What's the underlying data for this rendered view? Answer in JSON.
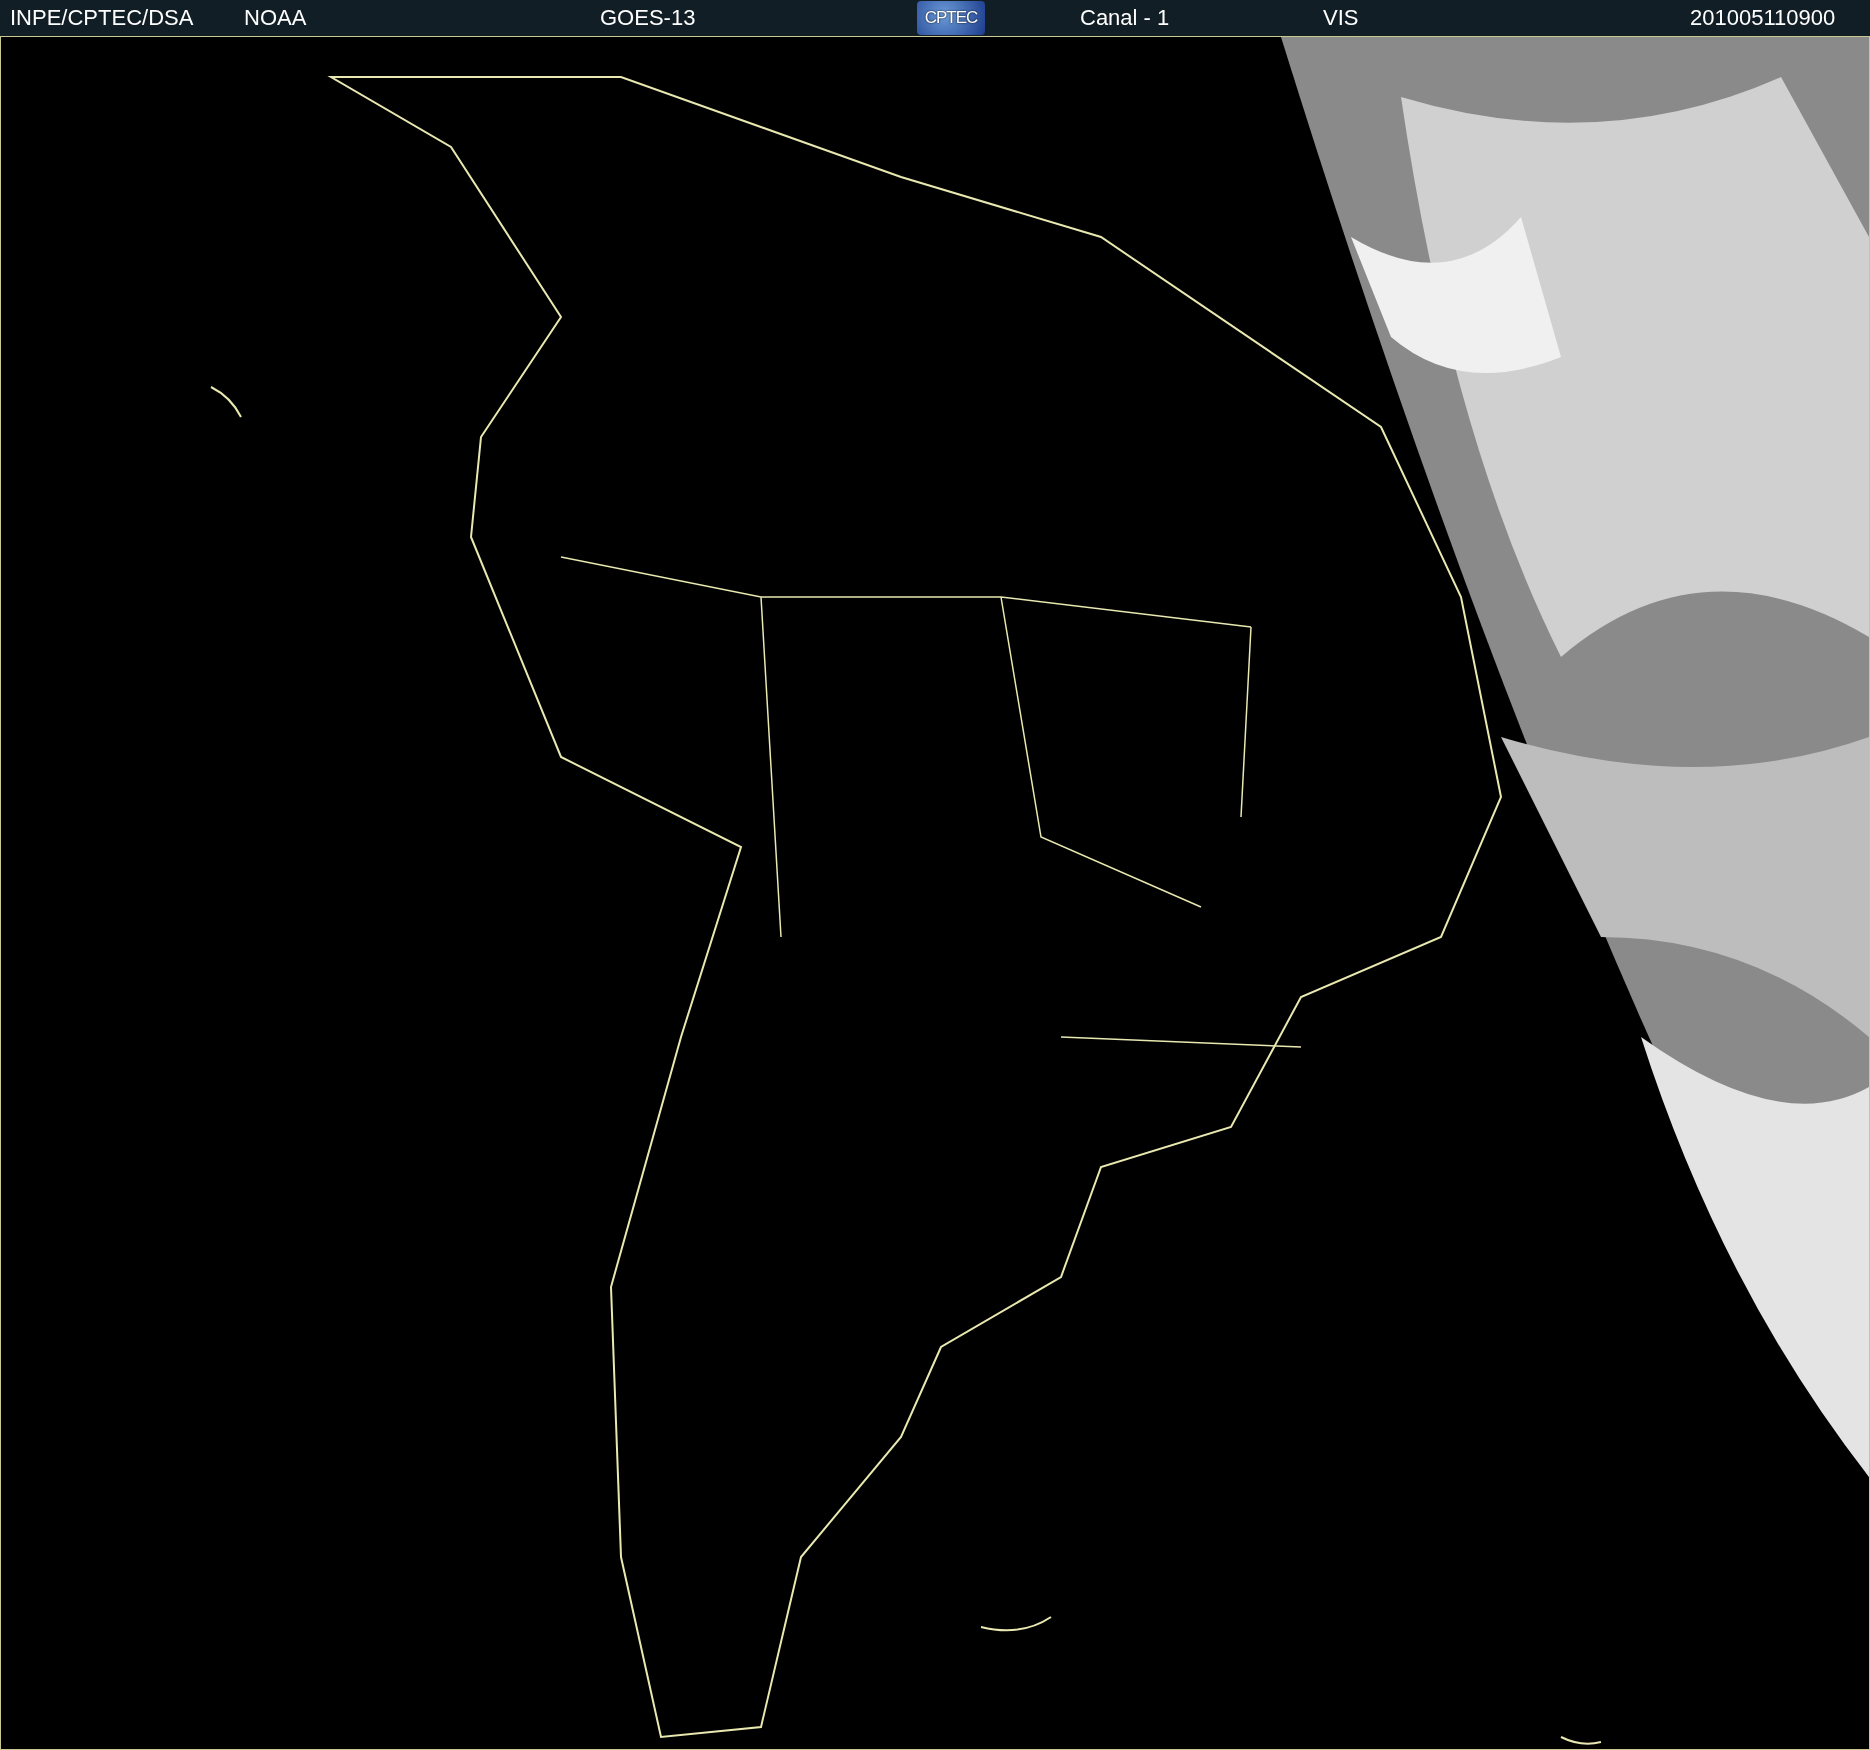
{
  "header": {
    "items": [
      {
        "kind": "text",
        "text": "INPE/CPTEC/DSA"
      },
      {
        "kind": "text",
        "text": "NOAA"
      },
      {
        "kind": "text",
        "text": "GOES-13"
      },
      {
        "kind": "logo",
        "text": "CPTEC"
      },
      {
        "kind": "text",
        "text": "Canal - 1"
      },
      {
        "kind": "text",
        "text": "VIS"
      },
      {
        "kind": "text",
        "text": "201005110900"
      }
    ]
  }
}
